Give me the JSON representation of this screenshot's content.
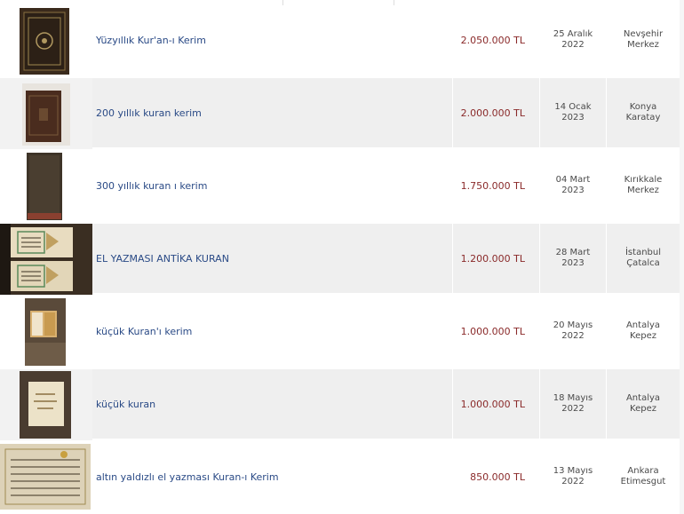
{
  "listings": [
    {
      "title": "Yüzyıllık Kur'an-ı Kerim",
      "price": "2.050.000 TL",
      "date": [
        "25 Aralık",
        "2022"
      ],
      "location": [
        "Nevşehir",
        "Merkez"
      ],
      "thumb_icon": "ornate-quran-photo"
    },
    {
      "title": "200 yıllık kuran kerim",
      "price": "2.000.000 TL",
      "date": [
        "14 Ocak",
        "2023"
      ],
      "location": [
        "Konya",
        "Karatay"
      ],
      "thumb_icon": "leather-book-photo"
    },
    {
      "title": "300 yıllık kuran ı kerim",
      "price": "1.750.000 TL",
      "date": [
        "04 Mart",
        "2023"
      ],
      "location": [
        "Kırıkkale",
        "Merkez"
      ],
      "thumb_icon": "dark-book-cover-photo"
    },
    {
      "title": "EL YAZMASI ANTİKA KURAN",
      "price": "1.200.000 TL",
      "date": [
        "28 Mart",
        "2023"
      ],
      "location": [
        "İstanbul",
        "Çatalca"
      ],
      "thumb_icon": "manuscript-pages-photo"
    },
    {
      "title": "küçük Kuran'ı kerim",
      "price": "1.000.000 TL",
      "date": [
        "20 Mayıs",
        "2022"
      ],
      "location": [
        "Antalya",
        "Kepez"
      ],
      "thumb_icon": "small-open-book-photo"
    },
    {
      "title": "küçük kuran",
      "price": "1.000.000 TL",
      "date": [
        "18 Mayıs",
        "2022"
      ],
      "location": [
        "Antalya",
        "Kepez"
      ],
      "thumb_icon": "small-book-in-hand-photo"
    },
    {
      "title": "altın yaldızlı el yazması Kuran-ı Kerim",
      "price": "850.000 TL",
      "date": [
        "13 Mayıs",
        "2022"
      ],
      "location": [
        "Ankara",
        "Etimesgut"
      ],
      "thumb_icon": "gilded-manuscript-photo"
    }
  ]
}
